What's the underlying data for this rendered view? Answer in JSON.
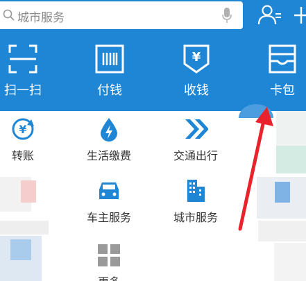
{
  "search": {
    "placeholder": "城市服务"
  },
  "toolbar": [
    {
      "label": "扫一扫",
      "icon": "scan-icon"
    },
    {
      "label": "付钱",
      "icon": "barcode-icon"
    },
    {
      "label": "收钱",
      "icon": "yen-shield-icon"
    },
    {
      "label": "卡包",
      "icon": "card-wallet-icon"
    }
  ],
  "services": [
    {
      "label": "转账",
      "icon": "transfer-icon"
    },
    {
      "label": "生活缴费",
      "icon": "utility-icon"
    },
    {
      "label": "交通出行",
      "icon": "transport-icon"
    },
    {
      "label": "车主服务",
      "icon": "car-icon"
    },
    {
      "label": "城市服务",
      "icon": "city-icon"
    },
    {
      "label": "更多",
      "icon": "more-grid-icon"
    }
  ],
  "colors": {
    "header": "#1f86d6",
    "icon": "#1f86d6",
    "arrow": "#e8232b"
  }
}
